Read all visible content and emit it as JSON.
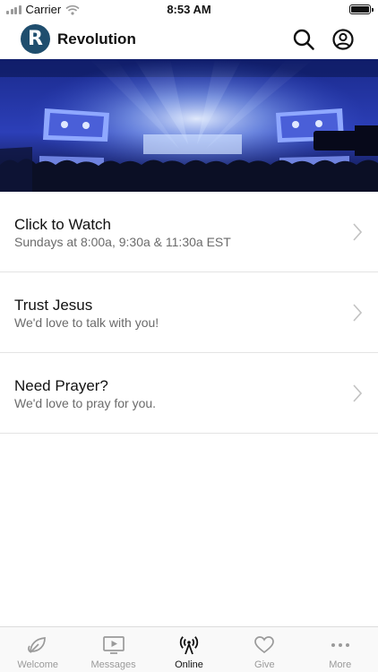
{
  "status_bar": {
    "carrier": "Carrier",
    "time": "8:53 AM"
  },
  "header": {
    "logo_letter": "R",
    "title": "Revolution"
  },
  "hero": {
    "description": "worship service stage with screens"
  },
  "list": [
    {
      "title": "Click to Watch",
      "subtitle": "Sundays at 8:00a, 9:30a & 11:30a EST"
    },
    {
      "title": "Trust Jesus",
      "subtitle": "We'd love to talk with you!"
    },
    {
      "title": "Need Prayer?",
      "subtitle": "We'd love to pray for you."
    }
  ],
  "tabs": [
    {
      "label": "Welcome",
      "icon": "leaf-icon",
      "active": false
    },
    {
      "label": "Messages",
      "icon": "play-screen-icon",
      "active": false
    },
    {
      "label": "Online",
      "icon": "broadcast-icon",
      "active": true
    },
    {
      "label": "Give",
      "icon": "heart-icon",
      "active": false
    },
    {
      "label": "More",
      "icon": "more-dots-icon",
      "active": false
    }
  ],
  "colors": {
    "brand": "#1f4e6e",
    "active_tab": "#111111",
    "inactive_tab": "#9a9a9a"
  }
}
